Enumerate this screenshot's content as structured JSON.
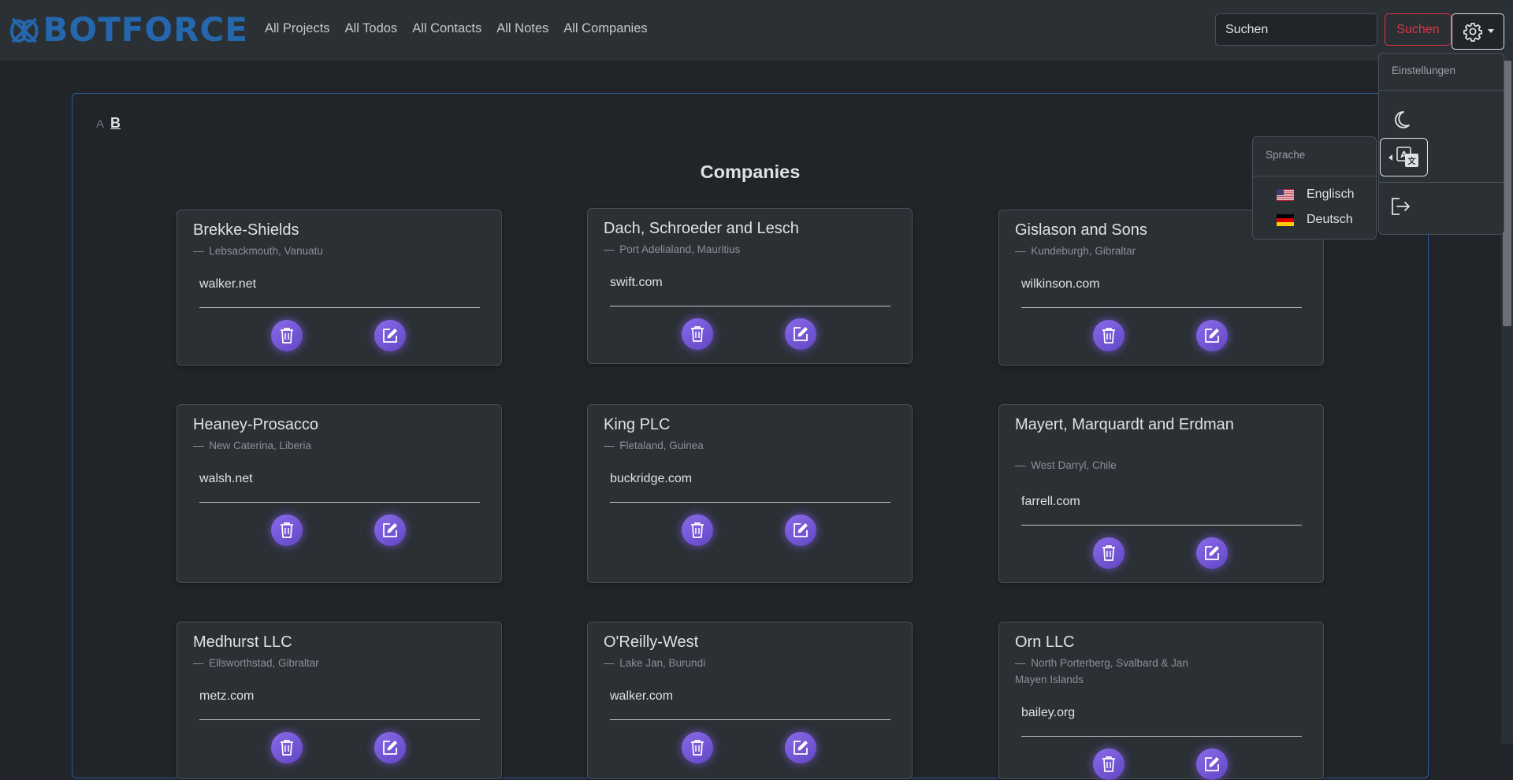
{
  "brand": {
    "name": "BOTFORCE"
  },
  "nav": {
    "links": [
      "All Projects",
      "All Todos",
      "All Contacts",
      "All Notes",
      "All Companies"
    ]
  },
  "search": {
    "placeholder": "Suchen",
    "button_label": "Suchen"
  },
  "settings_menu": {
    "header": "Einstellungen",
    "items": [
      "moon-icon",
      "translate-icon",
      "logout-icon"
    ]
  },
  "language_menu": {
    "header": "Sprache",
    "options": [
      {
        "label": "Englisch",
        "flag": "us-flag"
      },
      {
        "label": "Deutsch",
        "flag": "de-flag"
      }
    ]
  },
  "letters": {
    "inactive": "A",
    "active": "B"
  },
  "page": {
    "title": "Companies"
  },
  "companies": [
    {
      "name": "Brekke-Shields",
      "location": "Lebsackmouth, Vanuatu",
      "website": "walker.net"
    },
    {
      "name": "Dach, Schroeder and Lesch",
      "location": "Port Adelialand, Mauritius",
      "website": "swift.com"
    },
    {
      "name": "Gislason and Sons",
      "location": "Kundeburgh, Gibraltar",
      "website": "wilkinson.com"
    },
    {
      "name": "Heaney-Prosacco",
      "location": "New Caterina, Liberia",
      "website": "walsh.net"
    },
    {
      "name": "King PLC",
      "location": "Fletaland, Guinea",
      "website": "buckridge.com"
    },
    {
      "name": "Mayert, Marquardt and Erdman",
      "location": "West Darryl, Chile",
      "website": "farrell.com"
    },
    {
      "name": "Medhurst LLC",
      "location": "Ellsworthstad, Gibraltar",
      "website": "metz.com"
    },
    {
      "name": "O'Reilly-West",
      "location": "Lake Jan, Burundi",
      "website": "walker.com"
    },
    {
      "name": "Orn LLC",
      "location": "North Porterberg, Svalbard & Jan Mayen Islands",
      "website": "bailey.org"
    }
  ],
  "colors": {
    "background": "#212529",
    "navbar": "#2b3035",
    "brand": "#2467ad",
    "danger": "#dc3545",
    "action_purple": "#7456d8",
    "container_border": "#2c5aa0"
  }
}
